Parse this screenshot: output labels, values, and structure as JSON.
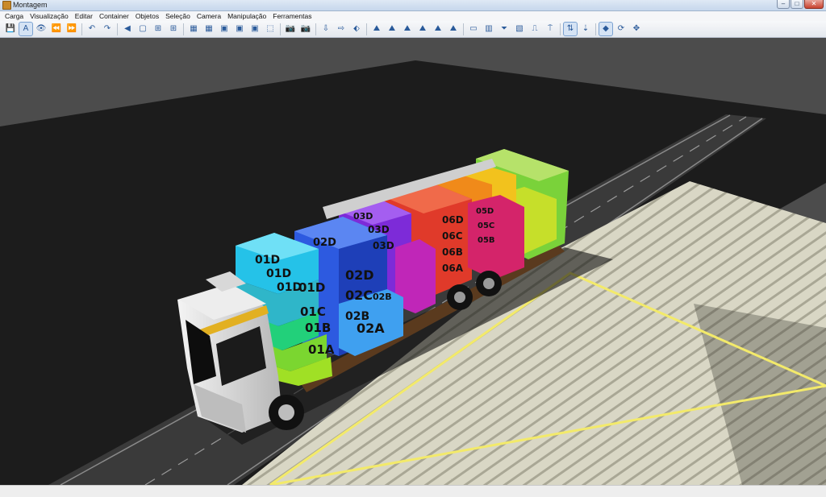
{
  "window": {
    "title": "Montagem",
    "buttons": {
      "minimize": "‒",
      "maximize": "□",
      "close": "✕"
    }
  },
  "menu": {
    "items": [
      "Carga",
      "Visualização",
      "Editar",
      "Container",
      "Objetos",
      "Seleção",
      "Camera",
      "Manipulação",
      "Ferramentas"
    ]
  },
  "toolbar": {
    "buttons": [
      {
        "name": "save-icon",
        "glyph": "💾"
      },
      {
        "name": "text-label-icon",
        "glyph": "A",
        "pressed": true
      },
      {
        "name": "eye-icon",
        "glyph": "👁"
      },
      {
        "name": "rewind-icon",
        "glyph": "⏪"
      },
      {
        "name": "fast-forward-icon",
        "glyph": "⏩"
      },
      {
        "sep": true
      },
      {
        "name": "undo-icon",
        "glyph": "↶"
      },
      {
        "name": "redo-icon",
        "glyph": "↷"
      },
      {
        "sep": true
      },
      {
        "name": "back-circle-icon",
        "glyph": "◀"
      },
      {
        "name": "frame-single-icon",
        "glyph": "▢"
      },
      {
        "name": "frame-grid-icon",
        "glyph": "⊞"
      },
      {
        "name": "frame-grid-alt-icon",
        "glyph": "⊞"
      },
      {
        "sep": true
      },
      {
        "name": "boxes-add-icon",
        "glyph": "▦"
      },
      {
        "name": "boxes-move-icon",
        "glyph": "▦"
      },
      {
        "name": "box-add-icon",
        "glyph": "▣"
      },
      {
        "name": "box-remove-icon",
        "glyph": "▣"
      },
      {
        "name": "box-delete-icon",
        "glyph": "▣"
      },
      {
        "name": "select-rect-icon",
        "glyph": "⬚"
      },
      {
        "sep": true
      },
      {
        "name": "camera-icon",
        "glyph": "📷"
      },
      {
        "name": "camera-box-icon",
        "glyph": "📷"
      },
      {
        "sep": true
      },
      {
        "name": "export-icon",
        "glyph": "⇩"
      },
      {
        "name": "import-icon",
        "glyph": "⇨"
      },
      {
        "name": "tag-icon",
        "glyph": "⬖"
      },
      {
        "sep": true
      },
      {
        "name": "axis-x-minus-icon",
        "glyph": "⛰"
      },
      {
        "name": "axis-x-plus-icon",
        "glyph": "⛰"
      },
      {
        "name": "axis-y-minus-icon",
        "glyph": "⛰"
      },
      {
        "name": "axis-y-plus-icon",
        "glyph": "⛰"
      },
      {
        "name": "axis-z-minus-icon",
        "glyph": "⛰"
      },
      {
        "name": "axis-z-plus-icon",
        "glyph": "⛰"
      },
      {
        "sep": true
      },
      {
        "name": "panel-icon",
        "glyph": "▭"
      },
      {
        "name": "pallet-icon",
        "glyph": "▥"
      },
      {
        "name": "filter-icon",
        "glyph": "⏷"
      },
      {
        "name": "fill-icon",
        "glyph": "▧"
      },
      {
        "name": "ruler-icon",
        "glyph": "⎍"
      },
      {
        "name": "pin-icon",
        "glyph": "⍑"
      },
      {
        "sep": true
      },
      {
        "name": "sort-icon",
        "glyph": "⇅",
        "pressed": true
      },
      {
        "name": "sort-down-icon",
        "glyph": "⇣"
      },
      {
        "sep": true
      },
      {
        "name": "cube-view-icon",
        "glyph": "◆",
        "pressed": true
      },
      {
        "name": "rotate-icon",
        "glyph": "⟳"
      },
      {
        "name": "move-axes-icon",
        "glyph": "✥"
      }
    ]
  },
  "scene": {
    "colors": {
      "ground": "#4c4c4c",
      "floor": "#1c1c1c",
      "road": "#3a3a3a",
      "warehouse": "#d8d6c4",
      "safety_line": "#f3ea6a",
      "truck": "#dcdcdc"
    },
    "box_labels": {
      "c01": [
        "01D",
        "01D",
        "01D",
        "01D",
        "01C",
        "01B",
        "01A"
      ],
      "c02": [
        "02D",
        "02D",
        "02C",
        "02B",
        "02B",
        "02A"
      ],
      "c03": [
        "03D",
        "03D",
        "03D"
      ],
      "c05": [
        "05D",
        "05C",
        "05B"
      ],
      "c06": [
        "06D",
        "06C",
        "06B",
        "06A"
      ]
    }
  }
}
